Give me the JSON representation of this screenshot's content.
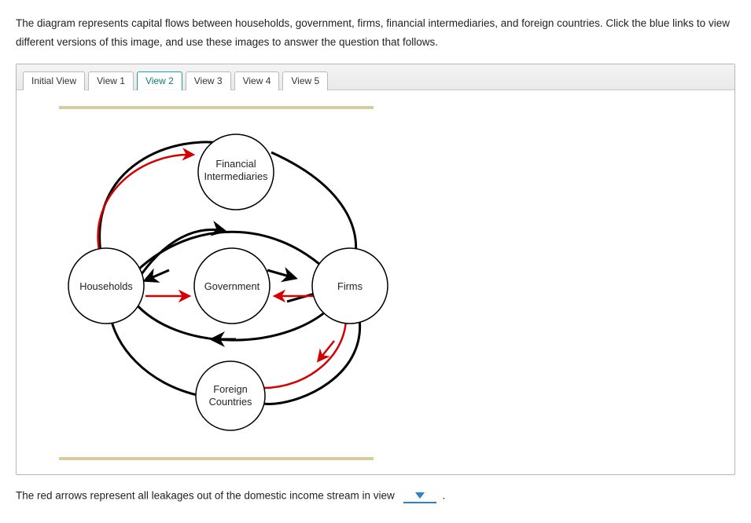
{
  "instructions": "The diagram represents capital flows between households, government, firms, financial intermediaries, and foreign countries. Click the blue links to view different versions of this image, and use these images to answer the question that follows.",
  "tabs": [
    {
      "label": "Initial View",
      "active": false
    },
    {
      "label": "View 1",
      "active": false
    },
    {
      "label": "View 2",
      "active": true
    },
    {
      "label": "View 3",
      "active": false
    },
    {
      "label": "View 4",
      "active": false
    },
    {
      "label": "View 5",
      "active": false
    }
  ],
  "diagram": {
    "nodes": {
      "households": "Households",
      "government": "Government",
      "firms": "Firms",
      "financial_line1": "Financial",
      "financial_line2": "Intermediaries",
      "foreign_line1": "Foreign",
      "foreign_line2": "Countries"
    },
    "flows": {
      "black": [
        {
          "from": "Households",
          "to": "Financial Intermediaries",
          "direction": "both"
        },
        {
          "from": "Financial Intermediaries",
          "to": "Firms",
          "direction": "to"
        },
        {
          "from": "Households",
          "to": "Government",
          "direction": "both"
        },
        {
          "from": "Government",
          "to": "Firms",
          "direction": "both"
        },
        {
          "from": "Households",
          "to": "Firms",
          "direction": "to_households",
          "note": "outer lower loop"
        },
        {
          "from": "Firms",
          "to": "Foreign Countries",
          "direction": "to_firms_loop"
        },
        {
          "from": "Households",
          "to": "Firms",
          "direction": "upper_outer_loop"
        }
      ],
      "red": [
        {
          "from": "Households",
          "to": "Financial Intermediaries"
        },
        {
          "from": "Households",
          "to": "Government"
        },
        {
          "from": "Firms",
          "to": "Government"
        },
        {
          "from": "Firms",
          "to": "Foreign Countries"
        }
      ]
    }
  },
  "question": {
    "prefix": "The red arrows represent all leakages out of the domestic income stream in view",
    "suffix": "."
  }
}
